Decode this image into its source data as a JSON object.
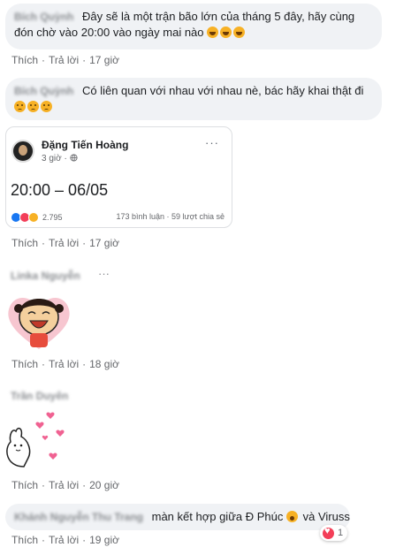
{
  "comments": [
    {
      "author": "Bích Quỳnh",
      "text_line1": "Đây sẽ là một trận bão lớn của tháng 5 đây, hãy cùng",
      "text_line2": "đón chờ vào 20:00 vào ngày mai nào",
      "emoji": [
        "rolling-on-floor-laughing",
        "rolling-on-floor-laughing",
        "rolling-on-floor-laughing"
      ],
      "like": "Thích",
      "reply": "Trả lời",
      "time": "17 giờ"
    },
    {
      "author": "Bích Quỳnh",
      "text": "Có liên quan với nhau với nhau nè, bác hãy khai thật đi",
      "emoji": [
        "disappointed-face",
        "disappointed-face",
        "disappointed-face"
      ],
      "like": "Thích",
      "reply": "Trả lời",
      "time": "17 giờ"
    },
    {
      "author": "Linka Nguyễn",
      "sticker": "sticker-laughing-girl",
      "like": "Thích",
      "reply": "Trả lời",
      "time": "18 giờ"
    },
    {
      "author": "Trần Duyên",
      "sticker": "sticker-bunny-hearts",
      "like": "Thích",
      "reply": "Trả lời",
      "time": "20 giờ"
    },
    {
      "author": "Khánh Nguyễn Thu Trang",
      "text_before": "màn kết hợp giữa Đ Phúc",
      "emoji": "face-screaming-in-fear",
      "text_after": "và Viruss",
      "reaction": "heart",
      "reaction_count": "1",
      "like": "Thích",
      "reply": "Trả lời",
      "time": "19 giờ"
    }
  ],
  "shared_post": {
    "name": "Đặng Tiến Hoàng",
    "time": "3 giờ ·",
    "content": "20:00 – 06/05",
    "reaction_count": "2.795",
    "comments": "173 bình luận",
    "shares": "59 lượt chia sẻ",
    "more": "···"
  },
  "more_icon": "···",
  "colors": {
    "bubble": "#f0f2f5",
    "meta": "#65676b",
    "like_blue": "#1877f2",
    "love_red": "#f33e58",
    "haha_yellow": "#f7b125"
  }
}
